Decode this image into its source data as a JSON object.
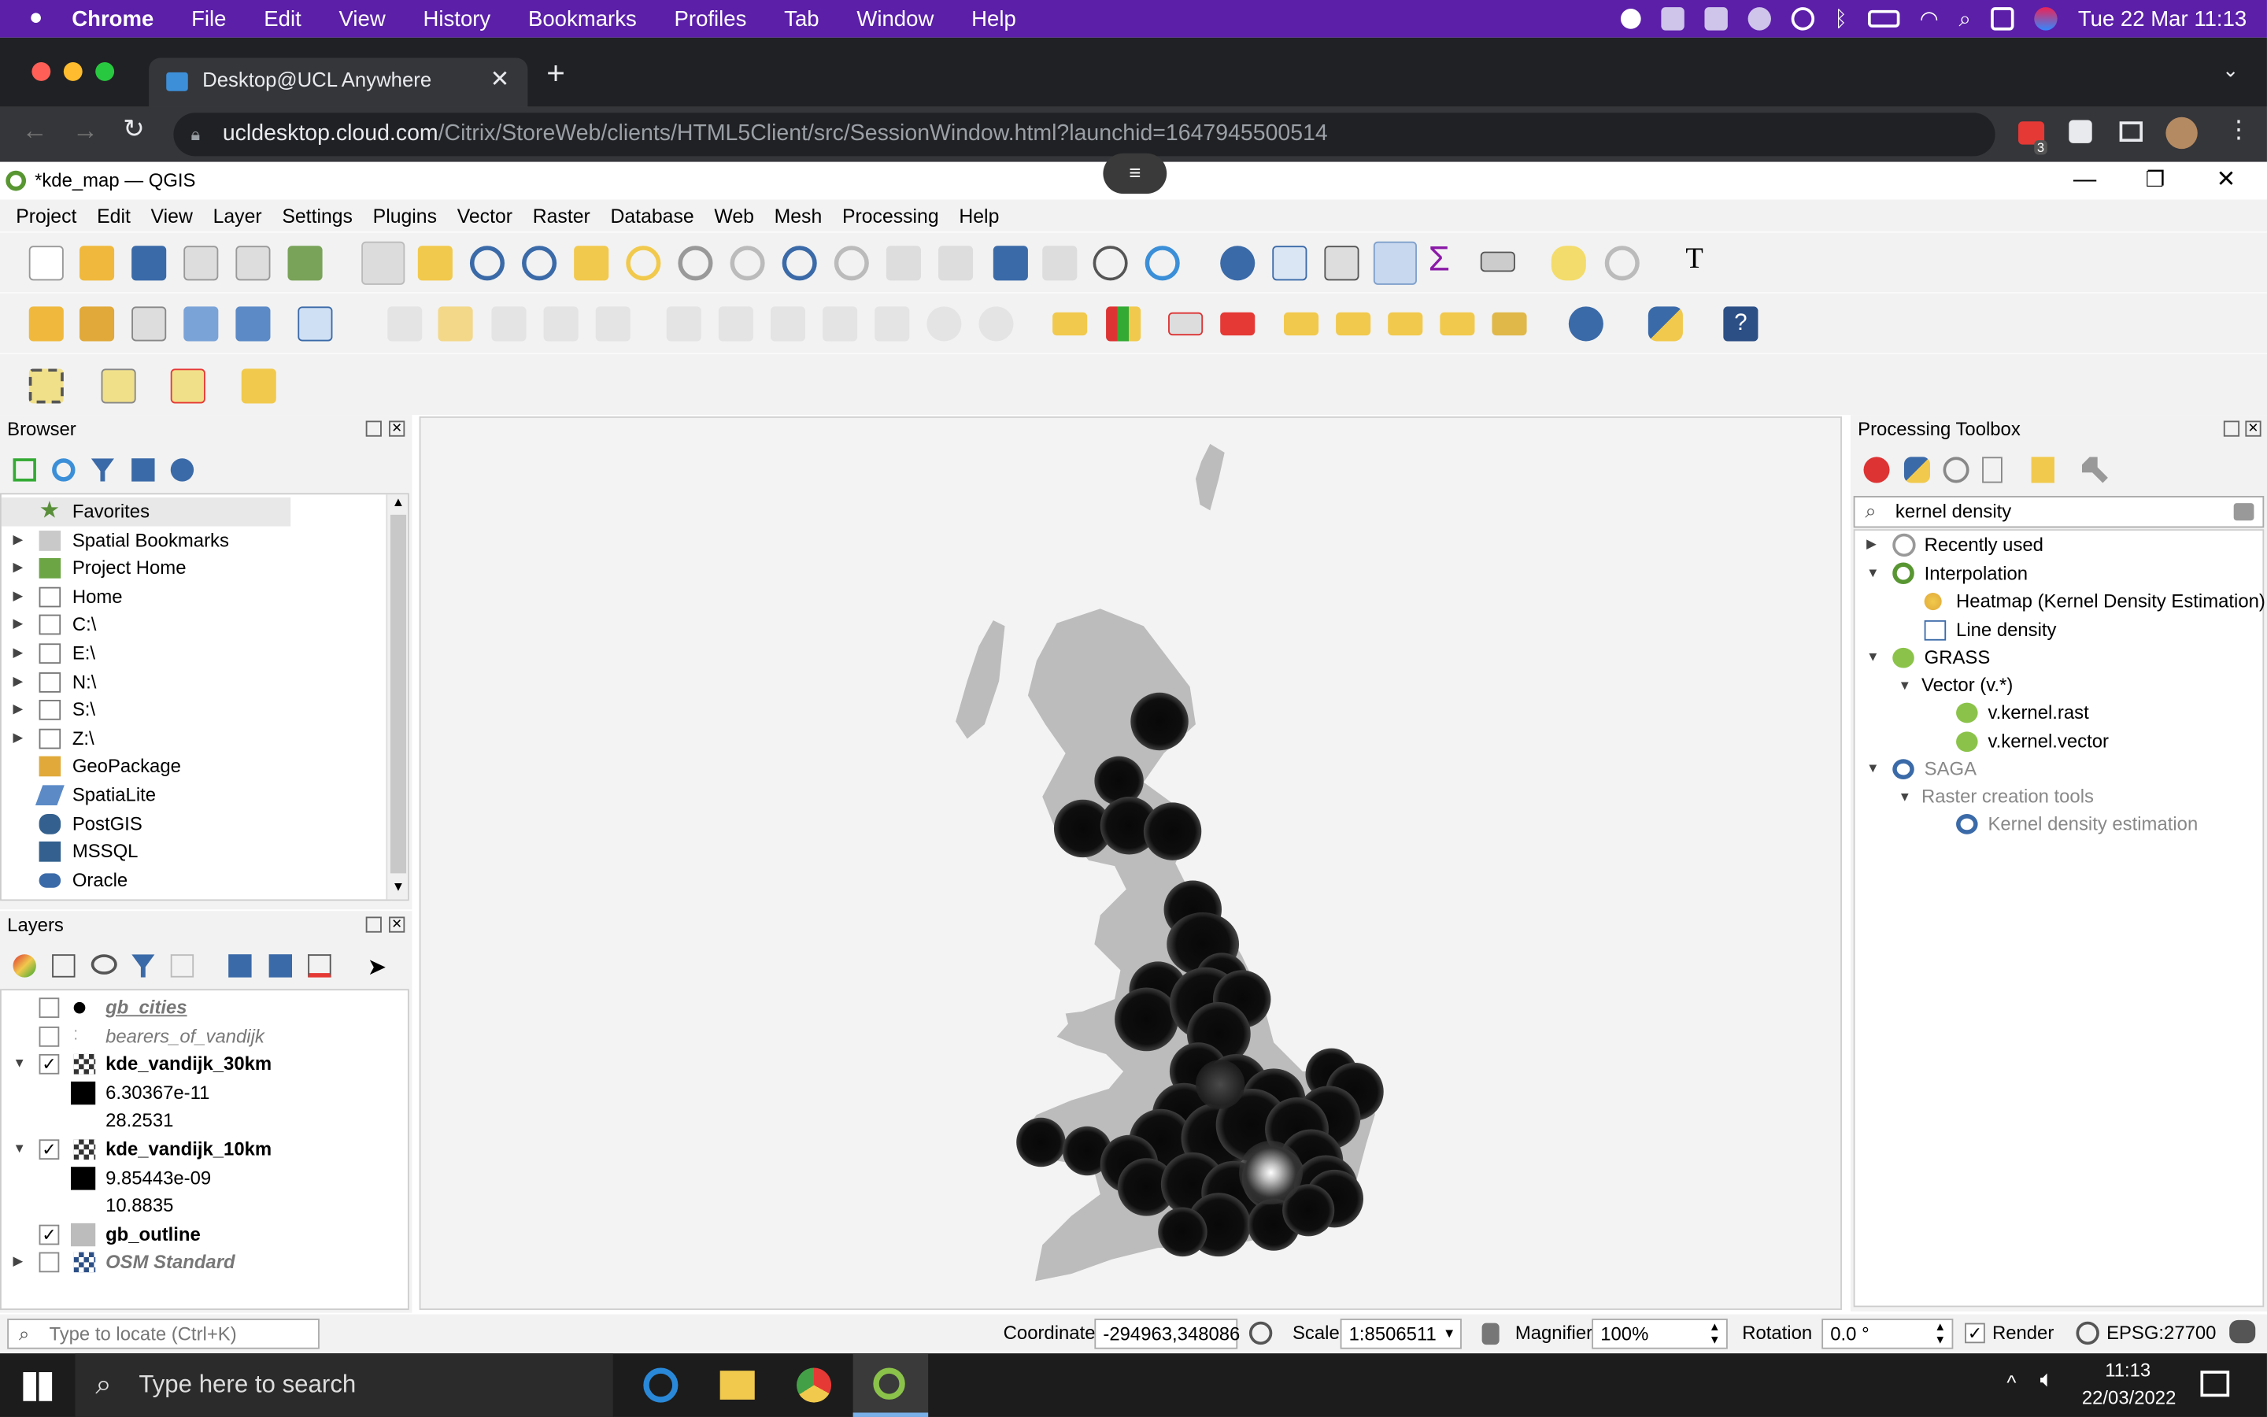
{
  "mac_menubar": {
    "app": "Chrome",
    "items": [
      "File",
      "Edit",
      "View",
      "History",
      "Bookmarks",
      "Profiles",
      "Tab",
      "Window",
      "Help"
    ],
    "clock": "Tue 22 Mar  11:13"
  },
  "browser": {
    "tab_title": "Desktop@UCL Anywhere",
    "url_host": "ucldesktop.cloud.com",
    "url_path": "/Citrix/StoreWeb/clients/HTML5Client/src/SessionWindow.html?launchid=1647945500514",
    "ext_badge": "3"
  },
  "qgis": {
    "title": "*kde_map — QGIS",
    "menu": [
      "Project",
      "Edit",
      "View",
      "Layer",
      "Settings",
      "Plugins",
      "Vector",
      "Raster",
      "Database",
      "Web",
      "Mesh",
      "Processing",
      "Help"
    ]
  },
  "browser_panel": {
    "title": "Browser",
    "items": [
      "Favorites",
      "Spatial Bookmarks",
      "Project Home",
      "Home",
      "C:\\",
      "E:\\",
      "N:\\",
      "S:\\",
      "Z:\\",
      "GeoPackage",
      "SpatiaLite",
      "PostGIS",
      "MSSQL",
      "Oracle"
    ]
  },
  "layers_panel": {
    "title": "Layers",
    "layers": [
      {
        "name": "gb_cities",
        "checked": false
      },
      {
        "name": "bearers_of_vandijk",
        "checked": false
      },
      {
        "name": "kde_vandijk_30km",
        "checked": true,
        "min": "6.30367e-11",
        "max": "28.2531"
      },
      {
        "name": "kde_vandijk_10km",
        "checked": true,
        "min": "9.85443e-09",
        "max": "10.8835"
      },
      {
        "name": "gb_outline",
        "checked": true
      },
      {
        "name": "OSM Standard",
        "checked": false
      }
    ]
  },
  "toolbox": {
    "title": "Processing Toolbox",
    "search_value": "kernel density",
    "items": {
      "recently_used": "Recently used",
      "interpolation": "Interpolation",
      "heatmap": "Heatmap (Kernel Density Estimation)",
      "line_density": "Line density",
      "grass": "GRASS",
      "vector_v": "Vector (v.*)",
      "v_kernel_rast": "v.kernel.rast",
      "v_kernel_vector": "v.kernel.vector",
      "saga": "SAGA",
      "raster_creation": "Raster creation tools",
      "kde": "Kernel density estimation"
    }
  },
  "statusbar": {
    "locate_placeholder": "Type to locate (Ctrl+K)",
    "coordinate_label": "Coordinate",
    "coordinate_value": "-294963,348086",
    "scale_label": "Scale",
    "scale_value": "1:8506511",
    "magnifier_label": "Magnifier",
    "magnifier_value": "100%",
    "rotation_label": "Rotation",
    "rotation_value": "0.0 °",
    "render_label": "Render",
    "crs": "EPSG:27700"
  },
  "taskbar": {
    "search_placeholder": "Type here to search",
    "time": "11:13",
    "date": "22/03/2022"
  },
  "colors": {
    "mac_menubar": "#5b1fa8",
    "chrome_dark": "#202124",
    "qgis_panel": "#f2f2f2",
    "gb_land": "#bcbcbc",
    "kde_blob": "#0e0e0e"
  }
}
